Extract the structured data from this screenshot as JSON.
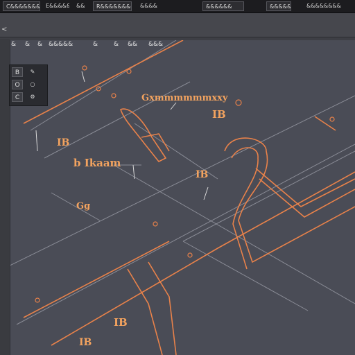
{
  "menu_tabs": [
    {
      "label": "C&&&&&&&"
    },
    {
      "label": "E&&&&&"
    },
    {
      "label": "&&"
    },
    {
      "label": "R&&&&&&&&"
    },
    {
      "label": "&&&&"
    },
    {
      "label": "&&&&&&"
    },
    {
      "label": "&&&&&&&"
    },
    {
      "label": "&&&&&&&&"
    }
  ],
  "viewport_toolbar": {
    "items": [
      "&",
      "&",
      "&",
      "&&&&&",
      "&",
      "&",
      "&&",
      "&&&"
    ]
  },
  "tool_panel": {
    "buttons": [
      "B",
      "O",
      "C"
    ],
    "icons": [
      "pencil-icon",
      "circle-icon",
      "gear-icon"
    ]
  },
  "drawing_labels": {
    "title": "Gxmmmmmmxxy",
    "dim_1": "IB",
    "dim_2": "IB",
    "dim_3": "IB",
    "dim_4": "IB",
    "note": "b Ikaam",
    "small_1": "Gg",
    "small_2": "IB"
  },
  "colors": {
    "accent": "#f3a35f",
    "line_orange": "#e9824a",
    "line_grey": "#8a8c96",
    "background": "#4a4c56"
  }
}
